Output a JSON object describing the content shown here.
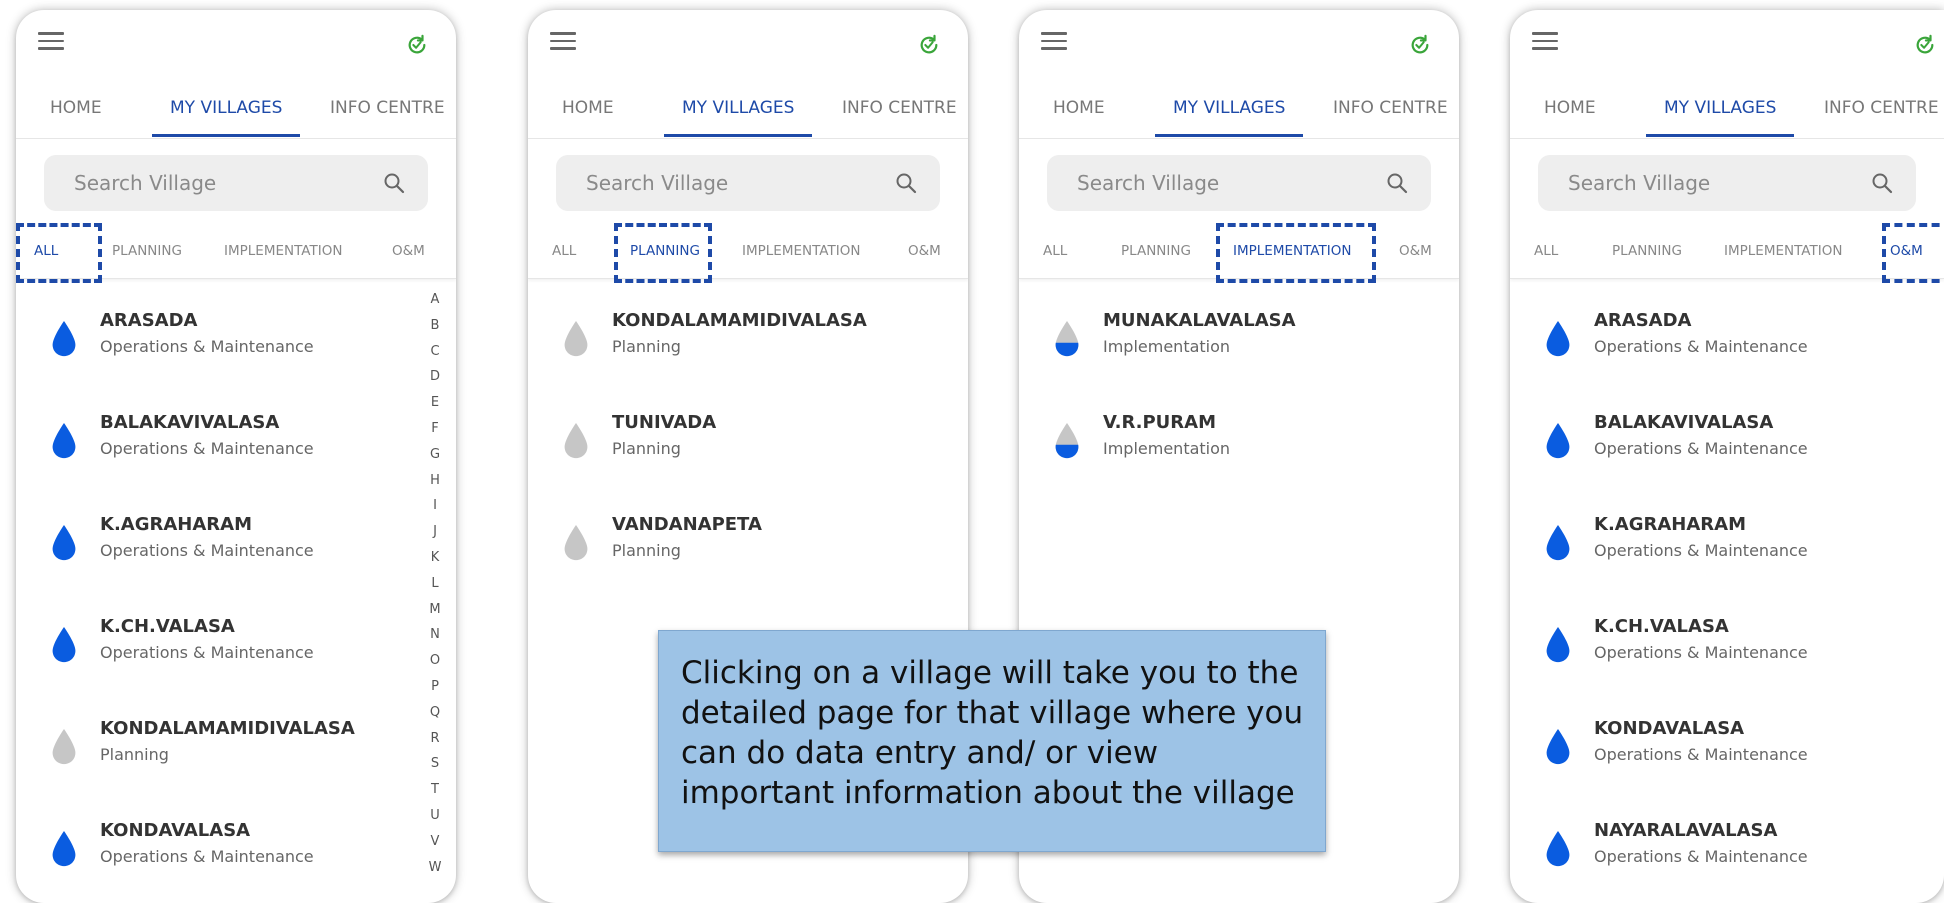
{
  "nav_tabs": {
    "home": "HOME",
    "my_villages": "MY VILLAGES",
    "info_centre": "INFO CENTRE"
  },
  "search": {
    "placeholder": "Search Village"
  },
  "filters": {
    "all": "ALL",
    "planning": "PLANNING",
    "implementation": "IMPLEMENTATION",
    "om": "O&M"
  },
  "colors": {
    "accent": "#1e4aa8",
    "drop_om": "#0a5ce0",
    "drop_planning": "#c6c6c6",
    "sync": "#3aa53a",
    "callout_bg": "#9dc3e6"
  },
  "screens": [
    {
      "active_filter": "all",
      "villages": [
        {
          "name": "ARASADA",
          "status": "Operations & Maintenance",
          "stage": "om"
        },
        {
          "name": "BALAKAVIVALASA",
          "status": "Operations & Maintenance",
          "stage": "om"
        },
        {
          "name": "K.AGRAHARAM",
          "status": "Operations & Maintenance",
          "stage": "om"
        },
        {
          "name": "K.CH.VALASA",
          "status": "Operations & Maintenance",
          "stage": "om"
        },
        {
          "name": "KONDALAMAMIDIVALASA",
          "status": "Planning",
          "stage": "planning"
        },
        {
          "name": "KONDAVALASA",
          "status": "Operations & Maintenance",
          "stage": "om"
        }
      ]
    },
    {
      "active_filter": "planning",
      "villages": [
        {
          "name": "KONDALAMAMIDIVALASA",
          "status": "Planning",
          "stage": "planning"
        },
        {
          "name": "TUNIVADA",
          "status": "Planning",
          "stage": "planning"
        },
        {
          "name": "VANDANAPETA",
          "status": "Planning",
          "stage": "planning"
        }
      ]
    },
    {
      "active_filter": "implementation",
      "villages": [
        {
          "name": "MUNAKALAVALASA",
          "status": "Implementation",
          "stage": "implementation"
        },
        {
          "name": "V.R.PURAM",
          "status": "Implementation",
          "stage": "implementation"
        }
      ]
    },
    {
      "active_filter": "om",
      "villages": [
        {
          "name": "ARASADA",
          "status": "Operations & Maintenance",
          "stage": "om"
        },
        {
          "name": "BALAKAVIVALASA",
          "status": "Operations & Maintenance",
          "stage": "om"
        },
        {
          "name": "K.AGRAHARAM",
          "status": "Operations & Maintenance",
          "stage": "om"
        },
        {
          "name": "K.CH.VALASA",
          "status": "Operations & Maintenance",
          "stage": "om"
        },
        {
          "name": "KONDAVALASA",
          "status": "Operations & Maintenance",
          "stage": "om"
        },
        {
          "name": "NAYARALAVALASA",
          "status": "Operations & Maintenance",
          "stage": "om"
        }
      ]
    }
  ],
  "alphabet_index": [
    "A",
    "B",
    "C",
    "D",
    "E",
    "F",
    "G",
    "H",
    "I",
    "J",
    "K",
    "L",
    "M",
    "N",
    "O",
    "P",
    "Q",
    "R",
    "S",
    "T",
    "U",
    "V",
    "W"
  ],
  "callout": {
    "text": "Clicking on a village will take you to the detailed page for that village where you can do data entry and/ or view important information about the village"
  }
}
